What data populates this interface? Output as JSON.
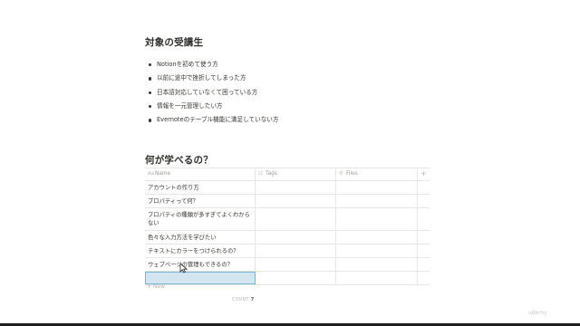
{
  "section1": {
    "title": "対象の受講生",
    "bullets": [
      "Notionを初めて使う方",
      "以前に途中で挫折してしまった方",
      "日本語対応していなくて困っている方",
      "情報を一元管理したい方",
      "Evernoteのテーブル機能に満足していない方"
    ]
  },
  "section2": {
    "title": "何が学べるの？"
  },
  "table": {
    "columns": [
      {
        "icon": "Aa",
        "label": "Name"
      },
      {
        "icon": "☷",
        "label": "Tags"
      },
      {
        "icon": "⚲",
        "label": "Files"
      }
    ],
    "add_column": "+",
    "rows": [
      "アカウントの作り方",
      "プロパティって何？",
      "プロパティの種類が多すぎてよくわからない",
      "色々な入力方法を学びたい",
      "テキストにカラーをつけられるの？",
      "ウェブページの管理もできるの？",
      ""
    ],
    "new_label": "+ New",
    "count_label": "COUNT",
    "count_value": "7"
  },
  "watermark": "udemy"
}
